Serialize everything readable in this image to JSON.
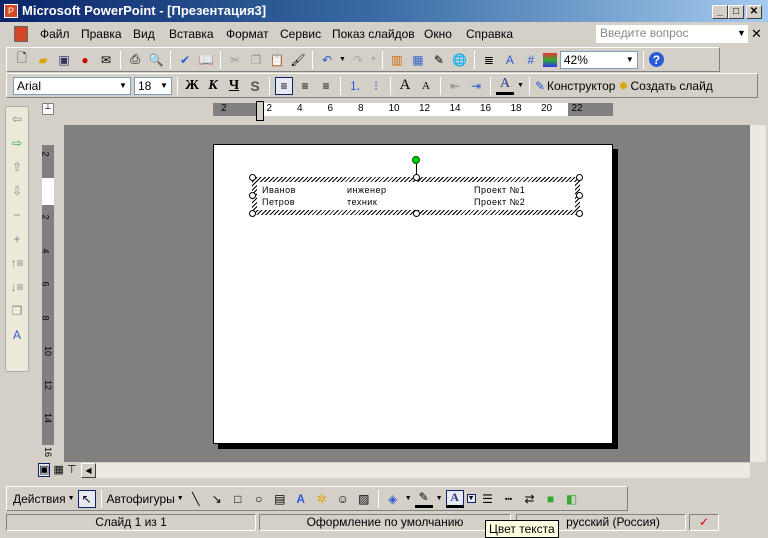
{
  "window": {
    "title": "Microsoft PowerPoint - [Презентация3]"
  },
  "menu": [
    "Файл",
    "Правка",
    "Вид",
    "Вставка",
    "Формат",
    "Сервис",
    "Показ слайдов",
    "Окно",
    "Справка"
  ],
  "ask_placeholder": "Введите вопрос",
  "standard": {
    "zoom": "42%"
  },
  "formatting": {
    "font": "Arial",
    "size": "18",
    "bold": "Ж",
    "italic": "К",
    "underline": "Ч",
    "shadow": "S",
    "designer": "Конструктор",
    "new_slide": "Создать слайд"
  },
  "hruler": [
    "2",
    "2",
    "4",
    "6",
    "8",
    "10",
    "12",
    "14",
    "16",
    "18",
    "20",
    "22"
  ],
  "vruler": [
    "2",
    "2",
    "4",
    "6",
    "8",
    "10",
    "12",
    "14",
    "16"
  ],
  "slide": {
    "rows": [
      [
        "Иванов",
        "инженер",
        "Проект №1"
      ],
      [
        "Петров",
        "техник",
        "Проект №2"
      ]
    ]
  },
  "drawing": {
    "actions": "Действия",
    "autoshapes": "Автофигуры"
  },
  "status": {
    "slide": "Слайд 1 из 1",
    "design": "Оформление по умолчанию",
    "language": "русский (Россия)"
  },
  "tooltip": "Цвет текста"
}
